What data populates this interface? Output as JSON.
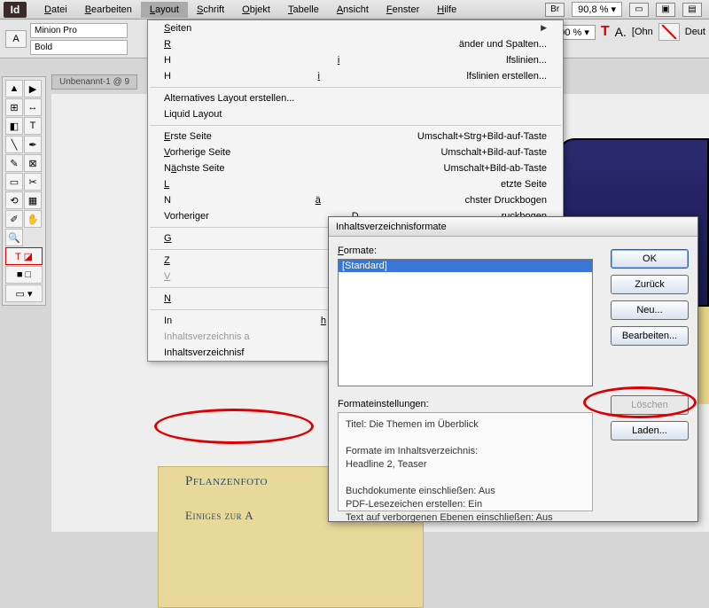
{
  "menubar": {
    "items": [
      "Datei",
      "Bearbeiten",
      "Layout",
      "Schrift",
      "Objekt",
      "Tabelle",
      "Ansicht",
      "Fenster",
      "Hilfe"
    ],
    "open_index": 2,
    "br_label": "Br",
    "zoom": "90,8 %"
  },
  "controlbar": {
    "font_family": "Minion Pro",
    "font_style": "Bold",
    "zoom2": "100 %",
    "ohn": "[Ohn",
    "deut": "Deut"
  },
  "doc_tab": "Unbenannt-1 @ 9",
  "dropdown": [
    {
      "label": "Seiten",
      "type": "sub"
    },
    {
      "label": "Ränder und Spalten...",
      "type": "item"
    },
    {
      "label": "Hilfslinien...",
      "type": "item"
    },
    {
      "label": "Hilfslinien erstellen...",
      "type": "item"
    },
    {
      "type": "sep"
    },
    {
      "label": "Alternatives Layout erstellen...",
      "type": "item"
    },
    {
      "label": "Liquid Layout",
      "type": "item"
    },
    {
      "type": "sep"
    },
    {
      "label": "Erste Seite",
      "shortcut": "Umschalt+Strg+Bild-auf-Taste",
      "type": "item"
    },
    {
      "label": "Vorherige Seite",
      "shortcut": "Umschalt+Bild-auf-Taste",
      "type": "item"
    },
    {
      "label": "Nächste Seite",
      "shortcut": "Umschalt+Bild-ab-Taste",
      "type": "item"
    },
    {
      "label": "Letzte Seite",
      "type": "item"
    },
    {
      "label": "Nächster Druckbogen",
      "type": "item"
    },
    {
      "label": "Vorheriger Druckbogen",
      "type": "item"
    },
    {
      "type": "sep"
    },
    {
      "label": "Gehe zu Seite...",
      "type": "item"
    },
    {
      "type": "sep"
    },
    {
      "label": "Zurück",
      "type": "item"
    },
    {
      "label": "Vor",
      "type": "disabled"
    },
    {
      "type": "sep"
    },
    {
      "label": "Nummerierungs- und Abschnitts",
      "type": "item"
    },
    {
      "type": "sep"
    },
    {
      "label": "Inhaltsverzeichnis...",
      "type": "item"
    },
    {
      "label": "Inhaltsverzeichnis aktualisieren",
      "type": "disabled"
    },
    {
      "label": "Inhaltsverzeichnisformate...",
      "type": "item"
    }
  ],
  "dialog": {
    "title": "Inhaltsverzeichnisformate",
    "formate_label": "Formate:",
    "list_item": "[Standard]",
    "settings_label": "Formateinstellungen:",
    "settings_lines": [
      "Titel: Die Themen im Überblick",
      "",
      "Formate im Inhaltsverzeichnis:",
      "Headline 2, Teaser",
      "",
      "Buchdokumente einschließen: Aus",
      "PDF-Lesezeichen erstellen: Ein",
      "Text auf verborgenen Ebenen einschließen: Aus"
    ],
    "buttons": {
      "ok": "OK",
      "zurueck": "Zurück",
      "neu": "Neu...",
      "bearbeiten": "Bearbeiten...",
      "loeschen": "Löschen",
      "laden": "Laden..."
    }
  },
  "doc_content": {
    "head1": "Pflanzenfoto",
    "head2": "Einiges zur A"
  }
}
